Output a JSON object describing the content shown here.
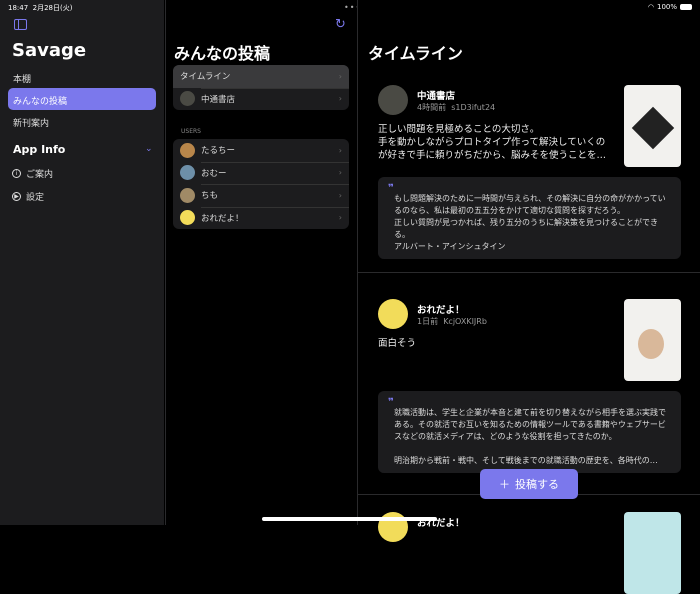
{
  "status": {
    "time": "18:47",
    "date": "2月28日(火)",
    "battery": "100%"
  },
  "sidebar": {
    "title": "Savage",
    "items": [
      {
        "label": "本棚"
      },
      {
        "label": "みんなの投稿",
        "selected": true
      },
      {
        "label": "新刊案内"
      }
    ],
    "section": "App Info",
    "info_items": [
      {
        "label": "ご案内",
        "icon": "info-icon"
      },
      {
        "label": "設定",
        "icon": "play-circle-icon"
      }
    ]
  },
  "middle": {
    "title": "みんなの投稿",
    "top_items": [
      {
        "label": "タイムライン"
      },
      {
        "label": "中通書店"
      }
    ],
    "users_header": "USERS",
    "users": [
      {
        "label": "たるちー"
      },
      {
        "label": "おむー"
      },
      {
        "label": "ちも"
      },
      {
        "label": "おれだよ！"
      }
    ]
  },
  "detail": {
    "title": "タイムライン",
    "posts": [
      {
        "name": "中通書店",
        "time": "4時間前",
        "id": "s1D3ifut24",
        "text": "正しい問題を見極めることの大切さ。\n手を動かしながらプロトタイプ作って解決していくのが好きで手に頼りがちだから、脳みそを使うことを…",
        "quote": "もし問題解決のために一時間が与えられ、その解決に自分の命がかかっているのなら、私は最初の五五分をかけて適切な質問を探すだろう。\n 正しい質問が見つかれば、残り五分のうちに解決策を見つけることができる。\nアルバート・アインシュタイン"
      },
      {
        "name": "おれだよ！",
        "time": "1日前",
        "id": "KcjOXKIJRb",
        "text": "面白そう",
        "quote": "就職活動は、学生と企業が本音と建て前を切り替えながら相手を選ぶ実践である。その就活でお互いを知るための情報ツールである書籍やウェブサービスなどの就活メディアは、どのような役割を担ってきたのか。\n\n明治期から戦前・戦中、そして戦後までの就職活動の歴史を、各時代の…"
      },
      {
        "name": "おれだよ！"
      }
    ],
    "post_button": "投稿する"
  }
}
